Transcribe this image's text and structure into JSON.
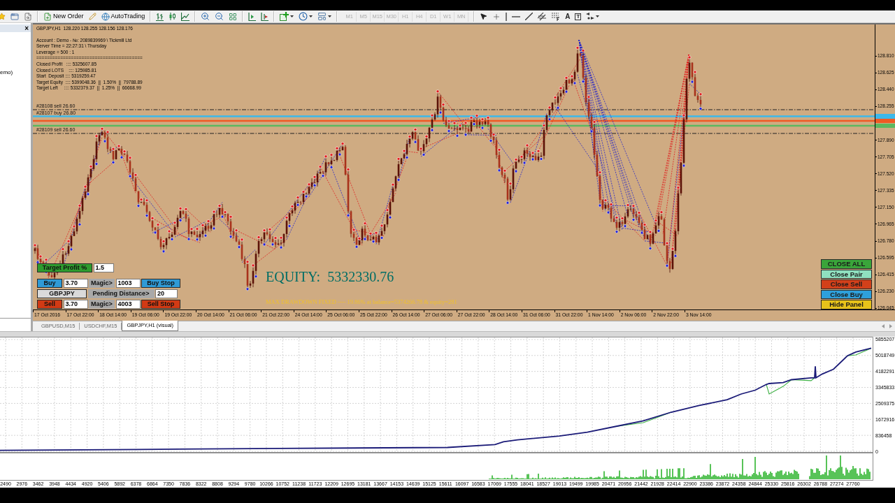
{
  "toolbar": {
    "buttons": [
      {
        "label": "New Order"
      },
      {
        "label": "AutoTrading"
      }
    ],
    "timeframes": [
      {
        "label": "M1",
        "disabled": true
      },
      {
        "label": "M5",
        "disabled": true
      },
      {
        "label": "M15",
        "disabled": true
      },
      {
        "label": "M30",
        "disabled": true
      },
      {
        "label": "H1",
        "disabled": true
      },
      {
        "label": "H4",
        "disabled": true
      },
      {
        "label": "D1",
        "disabled": true
      },
      {
        "label": "W1",
        "disabled": true
      },
      {
        "label": "MN",
        "disabled": true
      }
    ],
    "text_tool": "A",
    "label_tool": "T"
  },
  "navigator": {
    "close": "×",
    "item": "emo)"
  },
  "chart": {
    "header": "GBPJPY,H1  128.220 128.255 128.156 128.176",
    "info": [
      "Account : Demo - №: 2089839969 \\ Tickmill Ltd",
      "Server Time = 22:27:31 \\ Thursday",
      "Leverage = 500 : 1",
      "========================================",
      "Closed Profit   :::: 5325607.85",
      "Closed LOTS    :::: 125985.81",
      "Start  Deposit :::: 5319259.47",
      "Target Equity  :::: 5399048.36  ||  1.50%  ||  79788.89",
      "Target Left     :::: 5332379.37  ||  1.25%  ||  66668.99"
    ],
    "levels": [
      {
        "kind": "dashed",
        "label": "#28108 sell 26.60"
      },
      {
        "kind": "solid",
        "color": "#3cb8ea",
        "label": "#28107 buy 26.80"
      },
      {
        "kind": "solid",
        "color": "#f05a24"
      },
      {
        "kind": "solid",
        "color": "#5cb860"
      },
      {
        "kind": "dashed",
        "label": "#28109 sell 26.60"
      }
    ],
    "price_axis": [
      "128.810",
      "128.625",
      "128.440",
      "128.255",
      "127.890",
      "127.705",
      "127.520",
      "127.335",
      "127.150",
      "126.965",
      "126.780",
      "126.595",
      "126.415",
      "126.230",
      "126.045"
    ],
    "time_axis": [
      "17 Oct 2016",
      "17 Oct 22:00",
      "18 Oct 14:00",
      "19 Oct 06:00",
      "19 Oct 22:00",
      "20 Oct 14:00",
      "21 Oct 06:00",
      "21 Oct 22:00",
      "24 Oct 14:00",
      "25 Oct 06:00",
      "25 Oct 22:00",
      "26 Oct 14:00",
      "27 Oct 06:00",
      "27 Oct 22:00",
      "28 Oct 14:00",
      "31 Oct 06:00",
      "31 Oct 22:00",
      "1 Nov 14:00",
      "2 Nov 06:00",
      "2 Nov 22:00",
      "3 Nov 14:00"
    ],
    "equity": "EQUITY:  5332330.76",
    "drawdown": "MAX DRAWDOWN FIXED ---- 19.86% at balance=5374266.78 & equity=281",
    "panel": [
      [
        {
          "kind": "button",
          "label": "Target Profit %",
          "color": "#2e9b2e"
        },
        {
          "kind": "input",
          "value": "1.5"
        }
      ],
      [
        {
          "kind": "button",
          "label": "Buy",
          "color": "#2f9ad6"
        },
        {
          "kind": "input",
          "value": "3.70"
        },
        {
          "kind": "label",
          "label": "Magic>",
          "color": "#a9a9a9"
        },
        {
          "kind": "input",
          "value": "1003"
        },
        {
          "kind": "button",
          "label": "Buy Stop",
          "color": "#2f9ad6"
        }
      ],
      [
        {
          "kind": "button",
          "label": "GBPJPY",
          "color": "#dadada"
        },
        {
          "kind": "label",
          "label": "Pending Distance>",
          "color": "#a9a9a9"
        },
        {
          "kind": "input",
          "value": "20"
        }
      ],
      [
        {
          "kind": "button",
          "label": "Sell",
          "color": "#d23a14"
        },
        {
          "kind": "input",
          "value": "3.70"
        },
        {
          "kind": "label",
          "label": "Magic>",
          "color": "#a9a9a9"
        },
        {
          "kind": "input",
          "value": "4003"
        },
        {
          "kind": "button",
          "label": "Sell Stop",
          "color": "#d23a14"
        }
      ]
    ],
    "actions": [
      {
        "label": "CLOSE ALL",
        "color": "#3aa53a"
      },
      {
        "label": "Close Pair",
        "color": "#8fe0bf"
      },
      {
        "label": "Close Sell",
        "color": "#d2401a"
      },
      {
        "label": "Close Buy",
        "color": "#2ea0dc"
      },
      {
        "label": "Hide Panel",
        "color": "#e6c21a"
      }
    ]
  },
  "tabs": [
    {
      "label": "GBPUSD,M15",
      "selected": false
    },
    {
      "label": "USDCHF,M15",
      "selected": false
    },
    {
      "label": "GBPJPY,H1 (visual)",
      "selected": true
    }
  ],
  "tester_graph": {
    "chart_data": {
      "type": "line",
      "grid": true,
      "x": [
        2323,
        6493,
        10663,
        15667,
        17085,
        17335,
        17752,
        19003,
        19837,
        20671,
        21505,
        22339,
        23173,
        24007,
        24424,
        24841,
        25175,
        25258,
        25675,
        25925,
        26509,
        26613,
        26634,
        26655,
        26843,
        27176,
        27593,
        27843,
        28302
      ],
      "series": [
        {
          "color": "#1b1b78",
          "values": [
            50000,
            100000,
            150000,
            200000,
            350000,
            500000,
            600000,
            800000,
            1000000,
            1300000,
            1600000,
            2050000,
            2400000,
            2700000,
            3000000,
            3200000,
            3500000,
            3550000,
            3600000,
            3750000,
            3850000,
            3850000,
            4450000,
            3850000,
            4050000,
            4300000,
            5000000,
            5200000,
            5400000
          ]
        },
        {
          "color": "#3cb043",
          "values": [
            null,
            null,
            null,
            null,
            null,
            null,
            null,
            null,
            null,
            1300000,
            1500000,
            2050000,
            null,
            null,
            null,
            null,
            3500000,
            3000000,
            3400000,
            3750000,
            3700000,
            3850000,
            null,
            null,
            null,
            null,
            5000000,
            5050000,
            5400000
          ]
        }
      ],
      "xlim": [
        2323,
        28344
      ],
      "ylim": [
        0,
        6000000
      ],
      "xticks": [
        2490,
        2976,
        3462,
        3948,
        4434,
        4920,
        5406,
        5892,
        6378,
        6864,
        7350,
        7836,
        8322,
        8808,
        9294,
        9780,
        10266,
        10752,
        11238,
        11723,
        12209,
        12695,
        13181,
        13667,
        14153,
        14639,
        15125,
        15611,
        16097,
        16583,
        17069,
        17555,
        18041,
        18527,
        19013,
        19499,
        19985,
        20471,
        20956,
        21442,
        21928,
        22414,
        22900,
        23386,
        23872,
        24358,
        24844,
        25330,
        25816,
        26302,
        26788,
        27274,
        27760
      ],
      "yticks": [
        0,
        836458,
        1672916,
        2509375,
        3345833,
        4182291,
        5018749,
        5855207
      ]
    }
  }
}
